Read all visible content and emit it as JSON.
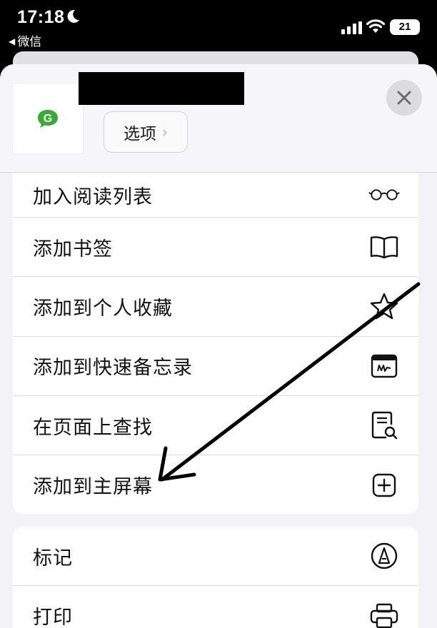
{
  "status_bar": {
    "time": "17:18",
    "back_app": "微信",
    "battery": "21"
  },
  "header": {
    "options_label": "选项",
    "options_chevron": "›"
  },
  "actions_group_1": [
    {
      "label": "加入阅读列表",
      "icon": "glasses-icon"
    },
    {
      "label": "添加书签",
      "icon": "book-icon"
    },
    {
      "label": "添加到个人收藏",
      "icon": "star-icon"
    },
    {
      "label": "添加到快速备忘录",
      "icon": "quick-note-icon"
    },
    {
      "label": "在页面上查找",
      "icon": "find-on-page-icon"
    },
    {
      "label": "添加到主屏幕",
      "icon": "add-square-icon"
    }
  ],
  "actions_group_2": [
    {
      "label": "标记",
      "icon": "markup-icon"
    },
    {
      "label": "打印",
      "icon": "printer-icon"
    }
  ],
  "colors": {
    "logo_green": "#3aa935",
    "sheet_bg": "#f2f2f7"
  }
}
